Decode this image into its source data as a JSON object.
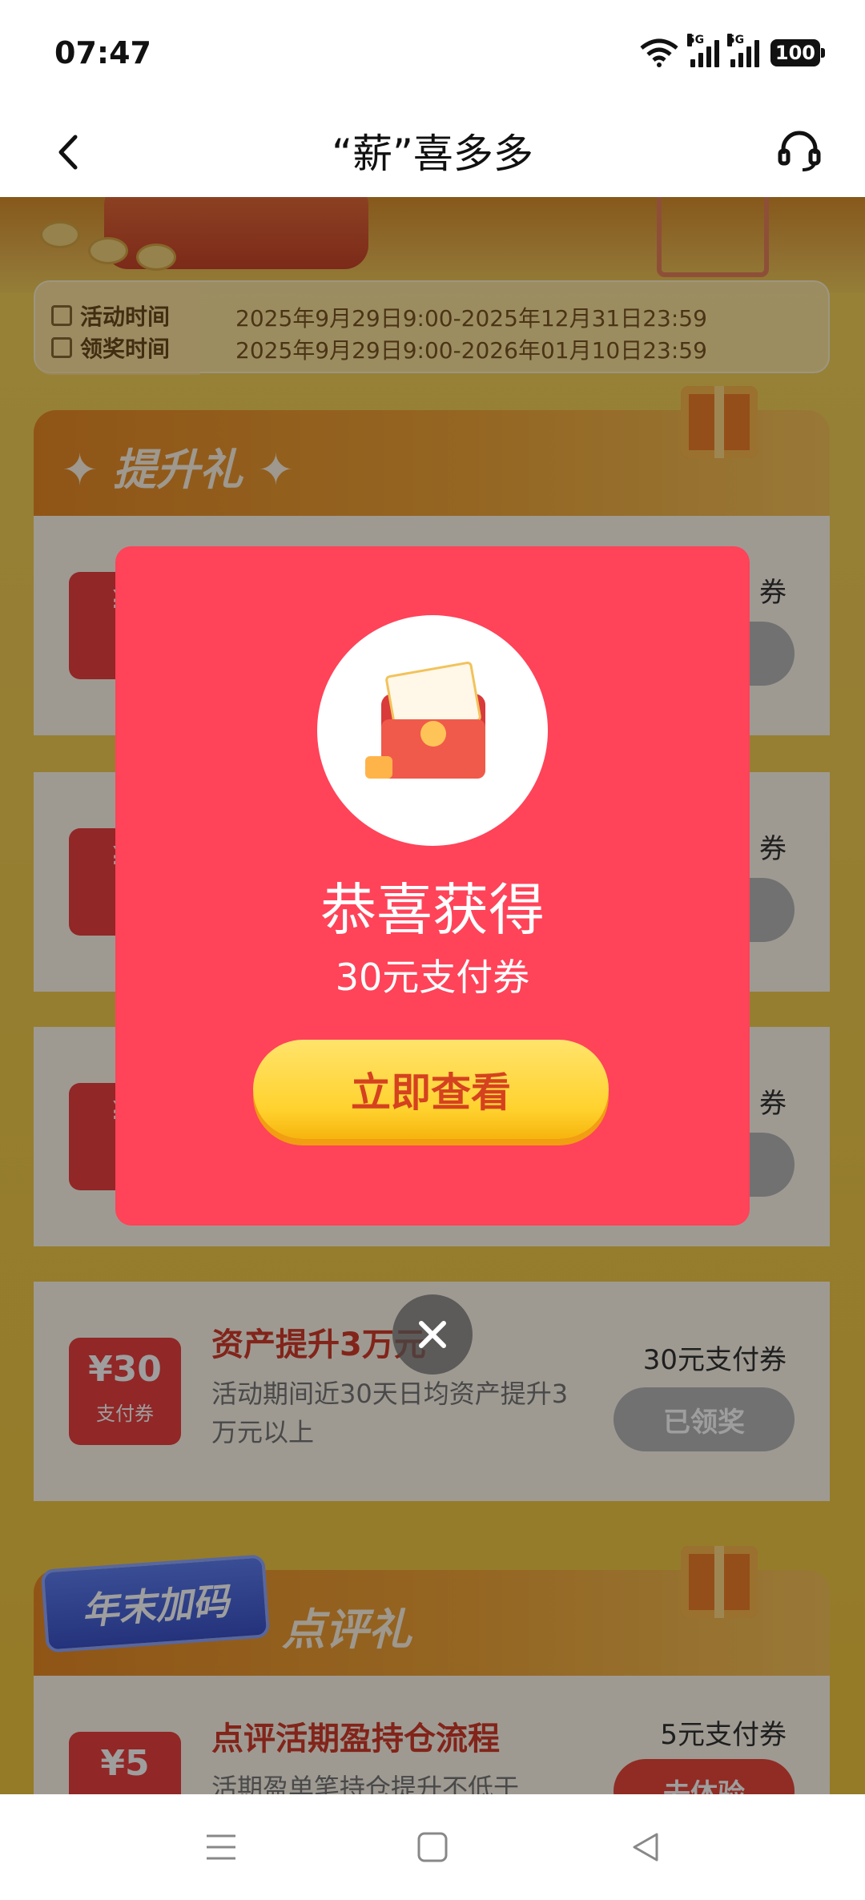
{
  "status_bar": {
    "time": "07:47",
    "network_left": "5G",
    "network_right": "5G",
    "battery": "100"
  },
  "header": {
    "title": "“薪”喜多多"
  },
  "activity_time": {
    "activity_label": "活动时间",
    "activity_value": "2025年9月29日9:00-2025年12月31日23:59",
    "claim_label": "领奖时间",
    "claim_value": "2025年9月29日9:00-2026年01月10日23:59"
  },
  "section_upgrade": {
    "title": "✦ 提升礼 ✦"
  },
  "cards": [
    {
      "coupon_amount": "¥30",
      "coupon_label": "支付券",
      "title": "资产提升3万元",
      "desc": "活动期间近30天日均资产提升3万元以上",
      "reward": "30元支付券",
      "button": "已领奖"
    }
  ],
  "partial_rows": [
    {
      "coupon_symbol": "¥",
      "coupon_label": "支",
      "reward_tail": "券"
    },
    {
      "coupon_symbol": "¥",
      "coupon_label": "支",
      "reward_tail": "券"
    },
    {
      "coupon_symbol": "¥",
      "coupon_label": "支",
      "reward_tail": "券"
    }
  ],
  "section_review": {
    "tag": "年末加码",
    "title": "点评礼"
  },
  "review_card": {
    "coupon_amount": "¥5",
    "title": "点评活期盈持仓流程",
    "desc": "活期盈单笔持仓提升不低于",
    "reward": "5元支付券",
    "button": "去体验"
  },
  "modal": {
    "title": "恭喜获得",
    "subtitle": "30元支付券",
    "button": "立即查看"
  }
}
